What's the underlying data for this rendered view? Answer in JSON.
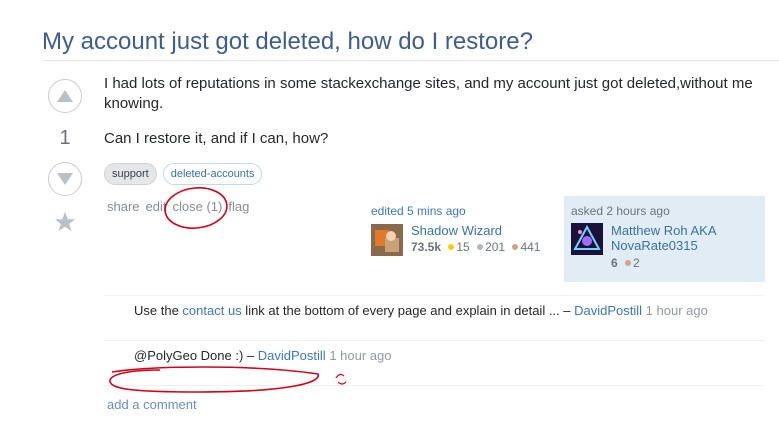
{
  "question": {
    "title": "My account just got deleted, how do I restore?",
    "vote_count": "1",
    "body_paragraphs": [
      "I had lots of reputations in some stackexchange sites, and my account just got deleted,without me knowing.",
      "Can I restore it, and if I can, how?"
    ],
    "tags": [
      "support",
      "deleted-accounts"
    ],
    "menu": {
      "share": "share",
      "edit": "edit",
      "close": "close (1)",
      "flag": "flag"
    }
  },
  "edited": {
    "action": "edited 5 mins ago",
    "user_name": "Shadow Wizard",
    "reputation": "73.5k",
    "gold": "15",
    "silver": "201",
    "bronze": "441"
  },
  "asked": {
    "action": "asked 2 hours ago",
    "user_name_line1": "Matthew Roh AKA",
    "user_name_line2": "NovaRate0315",
    "reputation": "6",
    "bronze": "2"
  },
  "comments": [
    {
      "prefix": "Use the ",
      "link": "contact us",
      "suffix": " link at the bottom of every page and explain in detail ... – ",
      "user": "DavidPostill",
      "time": "1 hour ago"
    },
    {
      "prefix": "@PolyGeo Done :) – ",
      "user": "DavidPostill",
      "time": "1 hour ago"
    }
  ],
  "add_comment": "add a comment",
  "colors": {
    "title": "#3e5d8c",
    "link": "#3d77b9",
    "gold": "#ffcc01",
    "silver": "#b4b8bc",
    "bronze": "#d1a684",
    "annotation_red": "#d0021b"
  }
}
